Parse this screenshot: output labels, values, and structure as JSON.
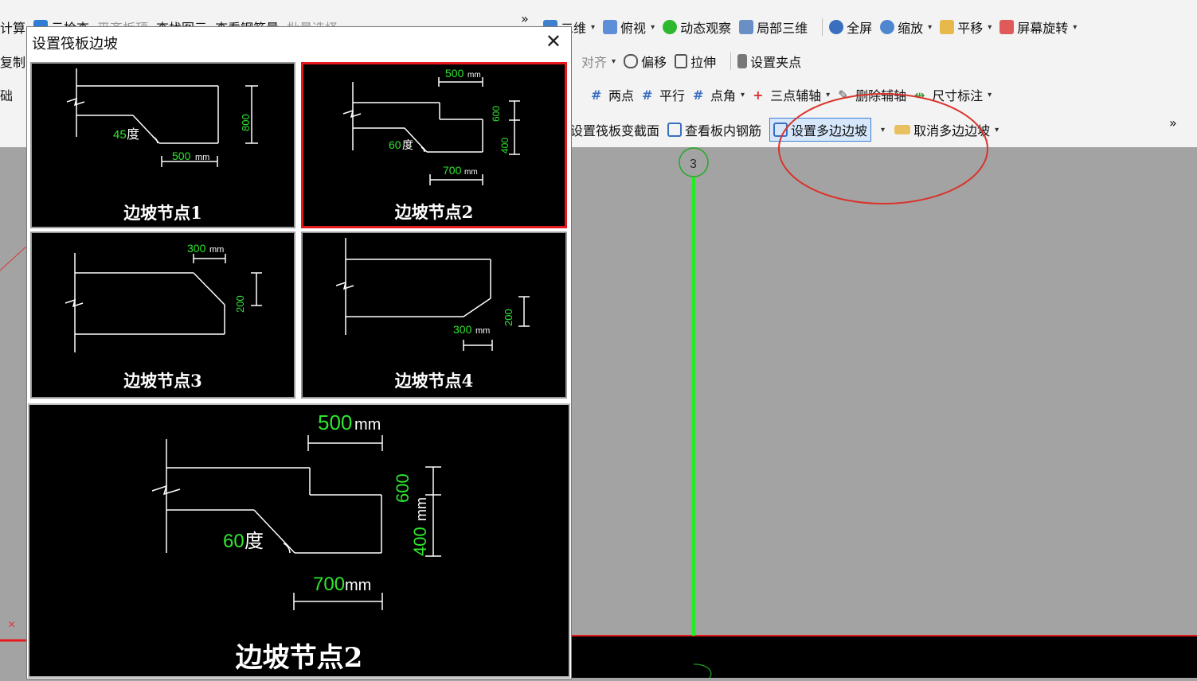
{
  "toolbar": {
    "row1_left": [
      "计算",
      "云检查",
      "平齐板顶",
      "查找图元",
      "查看钢筋量",
      "批量选择"
    ],
    "row1": [
      {
        "label": "二维",
        "dropdown": true
      },
      {
        "label": "俯视",
        "dropdown": true
      },
      {
        "label": "动态观察",
        "dropdown": false
      },
      {
        "label": "局部三维",
        "dropdown": false
      },
      {
        "label": "全屏",
        "dropdown": false
      },
      {
        "label": "缩放",
        "dropdown": true
      },
      {
        "label": "平移",
        "dropdown": true
      },
      {
        "label": "屏幕旋转",
        "dropdown": true
      }
    ],
    "row2_left": "复制",
    "row2": [
      {
        "label": "对齐",
        "dropdown": true
      },
      {
        "label": "偏移",
        "dropdown": false
      },
      {
        "label": "拉伸",
        "dropdown": false
      },
      {
        "label": "设置夹点",
        "dropdown": false
      }
    ],
    "row3_left": "础",
    "row3": [
      {
        "label": "两点",
        "dropdown": false
      },
      {
        "label": "平行",
        "dropdown": false
      },
      {
        "label": "点角",
        "dropdown": true
      },
      {
        "label": "三点辅轴",
        "dropdown": true
      },
      {
        "label": "删除辅轴",
        "dropdown": false
      },
      {
        "label": "尺寸标注",
        "dropdown": true
      }
    ],
    "row4": [
      {
        "label": "设置筏板变截面",
        "dropdown": false
      },
      {
        "label": "查看板内钢筋",
        "dropdown": false
      },
      {
        "label": "设置多边边坡",
        "dropdown": true,
        "selected": true
      },
      {
        "label": "取消多边边坡",
        "dropdown": true
      }
    ],
    "more": "»"
  },
  "canvas": {
    "axis_label": "3"
  },
  "dialog": {
    "title": "设置筏板边坡",
    "close": "✕",
    "nodes": [
      {
        "label": "边坡节点1",
        "dims": {
          "angle": "45",
          "angle_unit": "度",
          "width": "500",
          "unit": "mm",
          "height": "800"
        }
      },
      {
        "label": "边坡节点2",
        "selected": true,
        "dims": {
          "top": "500",
          "unit": "mm",
          "h1": "600",
          "h2": "400",
          "angle": "60",
          "angle_unit": "度",
          "bottom": "700"
        }
      },
      {
        "label": "边坡节点3",
        "dims": {
          "width": "300",
          "unit": "mm",
          "height": "200"
        }
      },
      {
        "label": "边坡节点4",
        "dims": {
          "width": "300",
          "unit": "mm",
          "height": "200"
        }
      }
    ],
    "preview": {
      "label": "边坡节点2",
      "top": "500",
      "unit": "mm",
      "h1": "600",
      "h2": "400",
      "h2_unit": "mm",
      "angle": "60",
      "angle_unit": "度",
      "bottom": "700",
      "bottom_unit": "mm"
    }
  },
  "colors": {
    "selection": "#e8191c",
    "dimension": "#2ee62e",
    "annotation_circle": "#d9342b",
    "axis": "#22ee22"
  }
}
